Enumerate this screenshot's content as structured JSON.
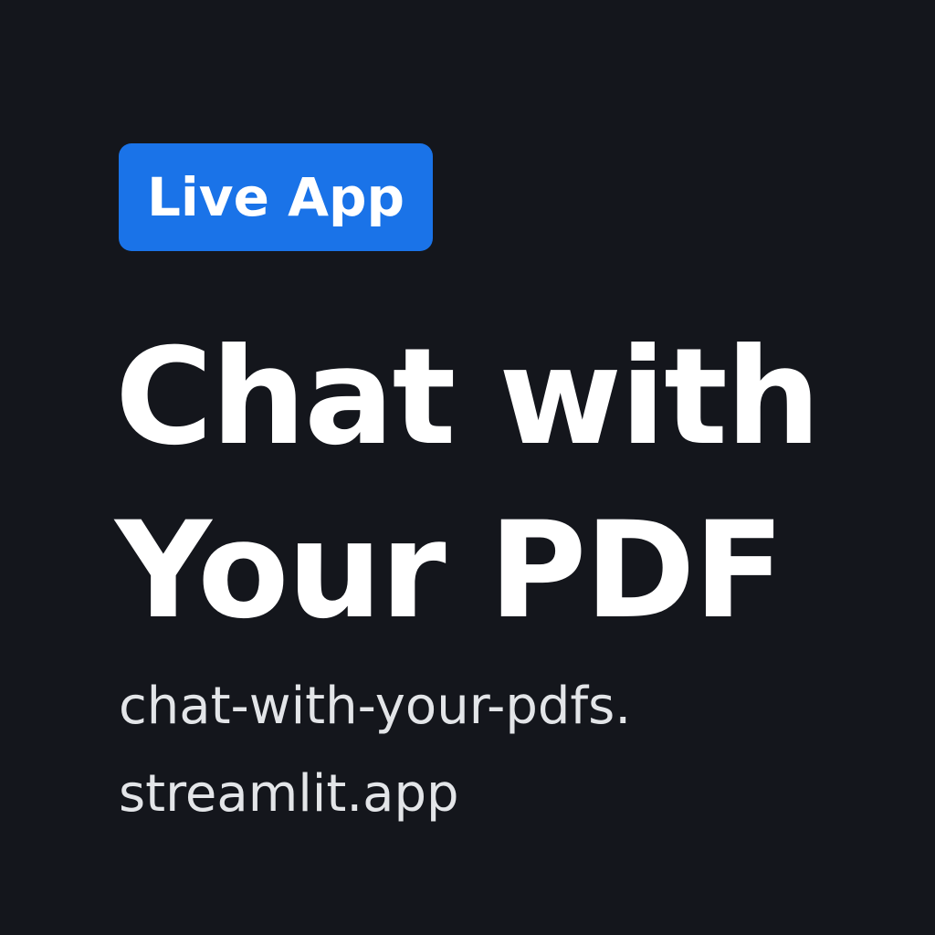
{
  "badge": {
    "label": "Live App",
    "color": "#1a73e8"
  },
  "headline": {
    "line1": "Chat with",
    "line2": "Your PDF"
  },
  "url": {
    "line1": "chat-with-your-pdfs.",
    "line2": "streamlit.app"
  },
  "colors": {
    "background": "#14161c",
    "headline_text": "#ffffff",
    "url_text": "#e3e5e8"
  }
}
